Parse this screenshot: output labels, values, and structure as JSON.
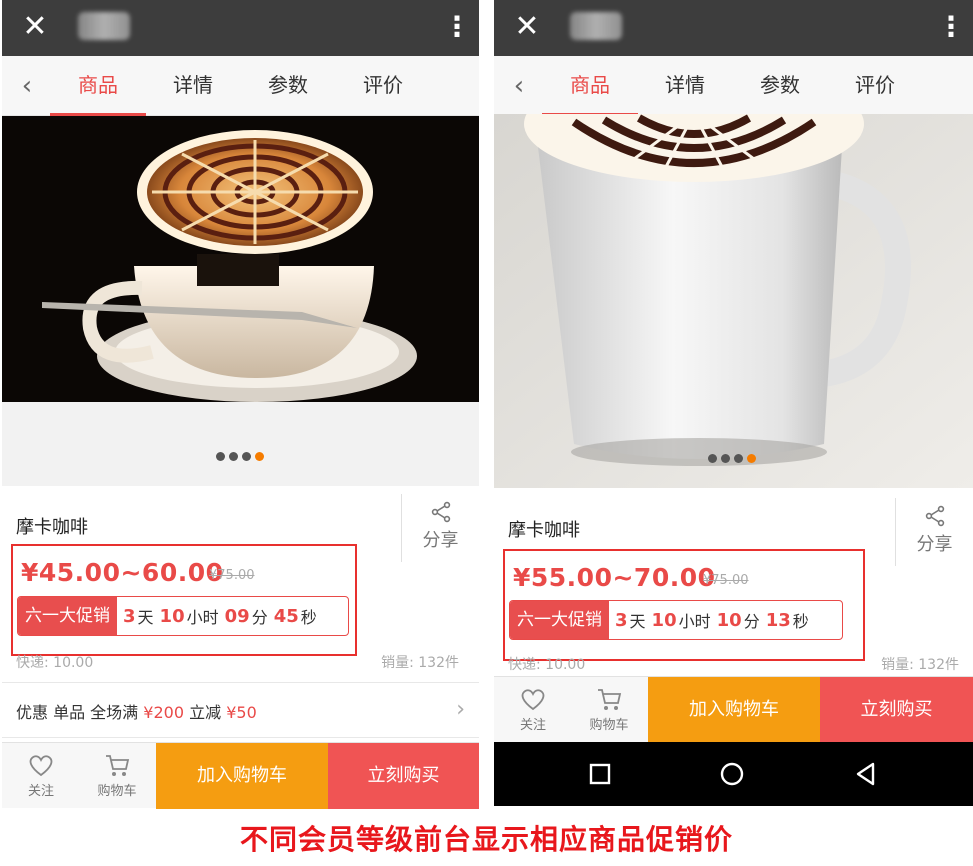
{
  "left": {
    "tabs": [
      "商品",
      "详情",
      "参数",
      "评价"
    ],
    "product_name": "摩卡咖啡",
    "share_label": "分享",
    "price_range": "¥45.00~60.00",
    "original_price": "¥75.00",
    "promo_tag": "六一大促销",
    "countdown": {
      "days": "3",
      "days_unit": "天",
      "hours": "10",
      "hours_unit": "小时",
      "minutes": "09",
      "minutes_unit": "分",
      "seconds": "45",
      "seconds_unit": "秒"
    },
    "shipping": "快递: 10.00",
    "sales": "销量: 132件",
    "coupon": {
      "label": "优惠 单品 全场满",
      "threshold": "¥200",
      "mid": "立减",
      "discount": "¥50"
    },
    "bottom": {
      "follow_label": "关注",
      "cart_label": "购物车",
      "add_cart_button": "加入购物车",
      "buy_now_button": "立刻购买"
    },
    "carousel": {
      "count": 4,
      "active_index": 3
    }
  },
  "right": {
    "tabs": [
      "商品",
      "详情",
      "参数",
      "评价"
    ],
    "product_name": "摩卡咖啡",
    "share_label": "分享",
    "price_range": "¥55.00~70.00",
    "original_price": "¥75.00",
    "promo_tag": "六一大促销",
    "countdown": {
      "days": "3",
      "days_unit": "天",
      "hours": "10",
      "hours_unit": "小时",
      "minutes": "10",
      "minutes_unit": "分",
      "seconds": "13",
      "seconds_unit": "秒"
    },
    "shipping": "快递: 10.00",
    "sales": "销量: 132件",
    "bottom": {
      "follow_label": "关注",
      "cart_label": "购物车",
      "add_cart_button": "加入购物车",
      "buy_now_button": "立刻购买"
    },
    "carousel": {
      "count": 4,
      "active_index": 3
    }
  },
  "caption": "不同会员等级前台显示相应商品促销价",
  "colors": {
    "accent_red": "#e94a48",
    "highlight_box": "#e8302e",
    "cart_orange": "#f59d11",
    "buy_red": "#f05454",
    "caption_red": "#e8171c",
    "active_dot": "#f57c00"
  },
  "icons": [
    "close-icon",
    "more-icon",
    "back-chevron-icon",
    "share-icon",
    "heart-icon",
    "cart-icon",
    "chevron-right-icon",
    "nav-back-icon",
    "nav-home-icon",
    "nav-recents-icon"
  ]
}
